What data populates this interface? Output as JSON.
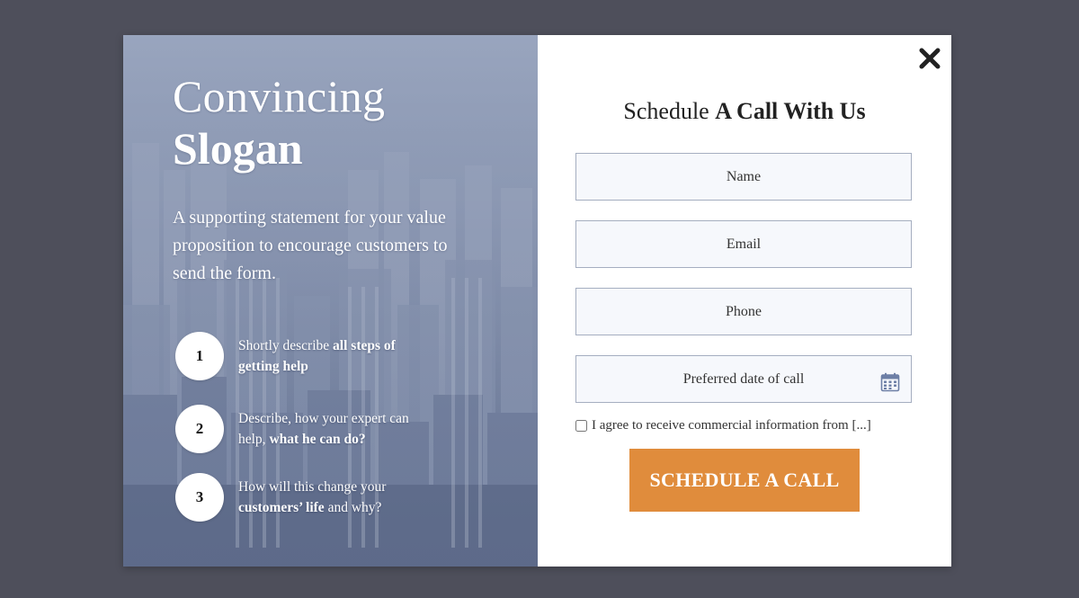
{
  "hero": {
    "headline_line1": "Convincing",
    "headline_line2": "Slogan",
    "supporting_text": "A supporting statement for your value proposition to encourage customers to send the form."
  },
  "steps": [
    {
      "number": "1",
      "text_plain": "Shortly describe ",
      "text_bold": "all steps of getting help",
      "text_after": ""
    },
    {
      "number": "2",
      "text_plain": "Describe, how your expert can help, ",
      "text_bold": "what he can do?",
      "text_after": ""
    },
    {
      "number": "3",
      "text_plain": "How will this change your ",
      "text_bold": "customers’ life",
      "text_after": " and why?"
    }
  ],
  "form": {
    "title_plain": "Schedule ",
    "title_bold": "A Call With Us",
    "name_placeholder": "Name",
    "email_placeholder": "Email",
    "phone_placeholder": "Phone",
    "date_placeholder": "Preferred date of call",
    "consent_label": "I agree to receive commercial information from [...]",
    "submit_label": "SCHEDULE A CALL"
  },
  "icons": {
    "close": "close-icon",
    "calendar": "calendar-icon"
  },
  "colors": {
    "backdrop": "#4e4f5b",
    "accent": "#e08c3c",
    "field_border": "#a5aec0",
    "calendar": "#6d7fa6"
  }
}
